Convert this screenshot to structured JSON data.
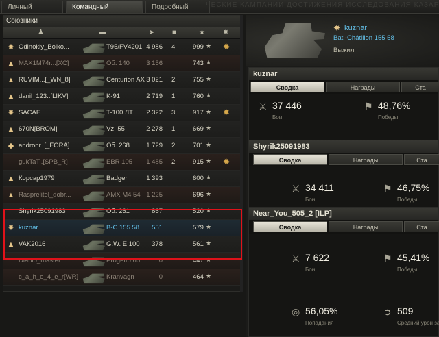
{
  "tabs": [
    {
      "label": "Личный результат",
      "active": false
    },
    {
      "label": "Командный результат",
      "active": true
    },
    {
      "label": "Подробный отчёт",
      "active": false
    }
  ],
  "bg_tabs_text": "ЧЕСКИЕ  КАМПАНИИ  ДОСТИЖЕНИЯ  ИССЛЕДОВАНИЯ  КАЗАРМЫ",
  "left_panel": {
    "title": "Союзники",
    "players": [
      {
        "badge": "star",
        "name": "Odinokiy_Bolko...",
        "tank": "T95/FV4201",
        "damage": "4 986",
        "kills": "4",
        "xp": "999",
        "medal": "sun",
        "state": "alive"
      },
      {
        "badge": "chevron",
        "name": "MAX1M74r...[XC]",
        "tank": "Об. 140",
        "damage": "3 156",
        "kills": "",
        "xp": "743",
        "medal": "",
        "state": "dead"
      },
      {
        "badge": "chevron",
        "name": "RUVIM...[_WN_8]",
        "tank": "Centurion AX",
        "damage": "3 021",
        "kills": "2",
        "xp": "755",
        "medal": "",
        "state": "alive"
      },
      {
        "badge": "chevron",
        "name": "danil_123..[LIKV]",
        "tank": "K-91",
        "damage": "2 719",
        "kills": "1",
        "xp": "760",
        "medal": "",
        "state": "alive"
      },
      {
        "badge": "star",
        "name": "SACAE",
        "tank": "T-100 ЛТ",
        "damage": "2 322",
        "kills": "3",
        "xp": "917",
        "medal": "sun",
        "state": "alive"
      },
      {
        "badge": "chevron",
        "name": "670N[BROM]",
        "tank": "Vz. 55",
        "damage": "2 278",
        "kills": "1",
        "xp": "669",
        "medal": "",
        "state": "alive"
      },
      {
        "badge": "diamond",
        "name": "andronr..[_FORA]",
        "tank": "Об. 268",
        "damage": "1 729",
        "kills": "2",
        "xp": "701",
        "medal": "",
        "state": "alive"
      },
      {
        "badge": "",
        "name": "gukTaT..[SPB_R]",
        "tank": "EBR 105",
        "damage": "1 485",
        "kills": "2",
        "xp": "915",
        "medal": "sun",
        "state": "dead"
      },
      {
        "badge": "chevron",
        "name": "Корсар1979",
        "tank": "Badger",
        "damage": "1 393",
        "kills": "",
        "xp": "600",
        "medal": "",
        "state": "alive"
      },
      {
        "badge": "chevron",
        "name": "Rasprelitel_dobr...",
        "tank": "AMX M4 54",
        "damage": "1 225",
        "kills": "",
        "xp": "696",
        "medal": "",
        "state": "dead"
      },
      {
        "badge": "",
        "name": "Shyrik25091983",
        "tank": "Об. 261",
        "damage": "867",
        "kills": "",
        "xp": "520",
        "medal": "",
        "state": "alive"
      },
      {
        "badge": "star",
        "name": "kuznar",
        "tank": "B-C 155 58",
        "damage": "551",
        "kills": "",
        "xp": "579",
        "medal": "",
        "state": "self"
      },
      {
        "badge": "chevron",
        "name": "VAK2016",
        "tank": "G.W. E 100",
        "damage": "378",
        "kills": "",
        "xp": "561",
        "medal": "",
        "state": "alive"
      },
      {
        "badge": "",
        "name": "Diablo_master",
        "tank": "Progetto 65",
        "damage": "0",
        "kills": "",
        "xp": "447",
        "medal": "",
        "state": "dead"
      },
      {
        "badge": "",
        "name": "c_a_h_e_4_e_r[WR]",
        "tank": "Kranvagn",
        "damage": "0",
        "kills": "",
        "xp": "464",
        "medal": "",
        "state": "dead"
      }
    ]
  },
  "vehicle": {
    "player": "kuznar",
    "tank": "Bat.-Châtillon 155 58",
    "status": "Выжил"
  },
  "cards": [
    {
      "title": "kuznar",
      "tabs": [
        "Сводка",
        "Награды",
        "Ста"
      ],
      "stats": [
        {
          "value": "37 446",
          "label": "Бои",
          "icon": "crossed-swords"
        },
        {
          "value": "48,76%",
          "label": "Победы",
          "icon": "flag"
        }
      ]
    },
    {
      "title": "Shyrik25091983",
      "tabs": [
        "Сводка",
        "Награды",
        "Ста"
      ],
      "stats": [
        {
          "value": "34 411",
          "label": "Бои",
          "icon": "crossed-swords"
        },
        {
          "value": "46,75%",
          "label": "Победы",
          "icon": "flag"
        }
      ]
    },
    {
      "title": "Near_You_505_2 [ILP]",
      "tabs": [
        "Сводка",
        "Награды",
        "Ста"
      ],
      "stats": [
        {
          "value": "7 622",
          "label": "Бои",
          "icon": "crossed-swords"
        },
        {
          "value": "45,41%",
          "label": "Победы",
          "icon": "flag"
        },
        {
          "value": "56,05%",
          "label": "Попадания",
          "icon": "target"
        },
        {
          "value": "509",
          "label": "Средний урон за",
          "icon": "shell"
        }
      ]
    }
  ],
  "colors": {
    "accent_blue": "#63c0e8",
    "highlight_red": "#e0121a",
    "medal_gold": "#d5a74b"
  }
}
